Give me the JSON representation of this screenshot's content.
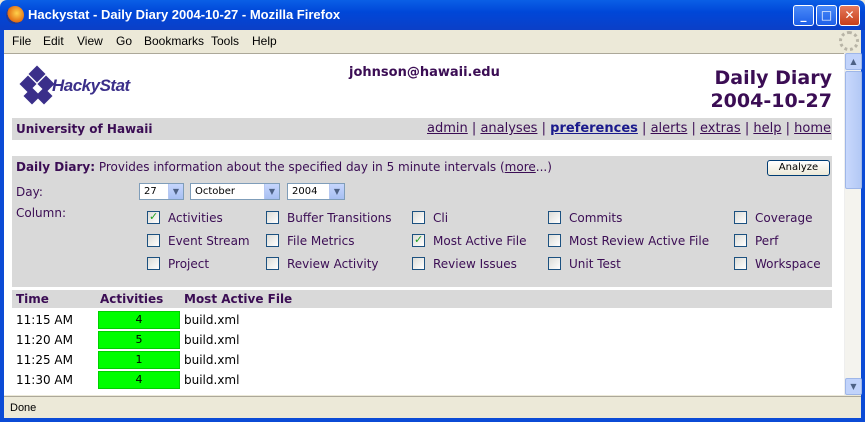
{
  "window": {
    "title": "Hackystat - Daily Diary 2004-10-27 - Mozilla Firefox",
    "controls": {
      "minimize": "_",
      "maximize": "□",
      "close": "✕"
    }
  },
  "menu": [
    "File",
    "Edit",
    "View",
    "Go",
    "Bookmarks",
    "Tools",
    "Help"
  ],
  "header": {
    "logo_text": "HackyStat",
    "email": "johnson@hawaii.edu",
    "title_line1": "Daily Diary",
    "title_line2": "2004-10-27"
  },
  "nav": {
    "organization": "University of Hawaii",
    "links": [
      "admin",
      "analyses",
      "preferences",
      "alerts",
      "extras",
      "help",
      "home"
    ],
    "active": "preferences",
    "separator": "|"
  },
  "analysis": {
    "name": "Daily Diary:",
    "description": "Provides information about the specified day in 5 minute intervals (",
    "more_link": "more",
    "description_end": "...)",
    "analyze_button": "Analyze",
    "day_label": "Day:",
    "column_label": "Column:",
    "day": {
      "day": "27",
      "month": "October",
      "year": "2004"
    },
    "columns": [
      {
        "label": "Activities",
        "checked": true
      },
      {
        "label": "Buffer Transitions",
        "checked": false
      },
      {
        "label": "Cli",
        "checked": false
      },
      {
        "label": "Commits",
        "checked": false
      },
      {
        "label": "Coverage",
        "checked": false
      },
      {
        "label": "Event Stream",
        "checked": false
      },
      {
        "label": "File Metrics",
        "checked": false
      },
      {
        "label": "Most Active File",
        "checked": true
      },
      {
        "label": "Most Review Active File",
        "checked": false
      },
      {
        "label": "Perf",
        "checked": false
      },
      {
        "label": "Project",
        "checked": false
      },
      {
        "label": "Review Activity",
        "checked": false
      },
      {
        "label": "Review Issues",
        "checked": false
      },
      {
        "label": "Unit Test",
        "checked": false
      },
      {
        "label": "Workspace",
        "checked": false
      }
    ]
  },
  "table": {
    "headers": [
      "Time",
      "Activities",
      "Most Active File"
    ],
    "activity_color": "#00ff00",
    "rows": [
      {
        "time": "11:15 AM",
        "activities": "4",
        "file": "build.xml"
      },
      {
        "time": "11:20 AM",
        "activities": "5",
        "file": "build.xml"
      },
      {
        "time": "11:25 AM",
        "activities": "1",
        "file": "build.xml"
      },
      {
        "time": "11:30 AM",
        "activities": "4",
        "file": "build.xml"
      }
    ]
  },
  "status": "Done"
}
